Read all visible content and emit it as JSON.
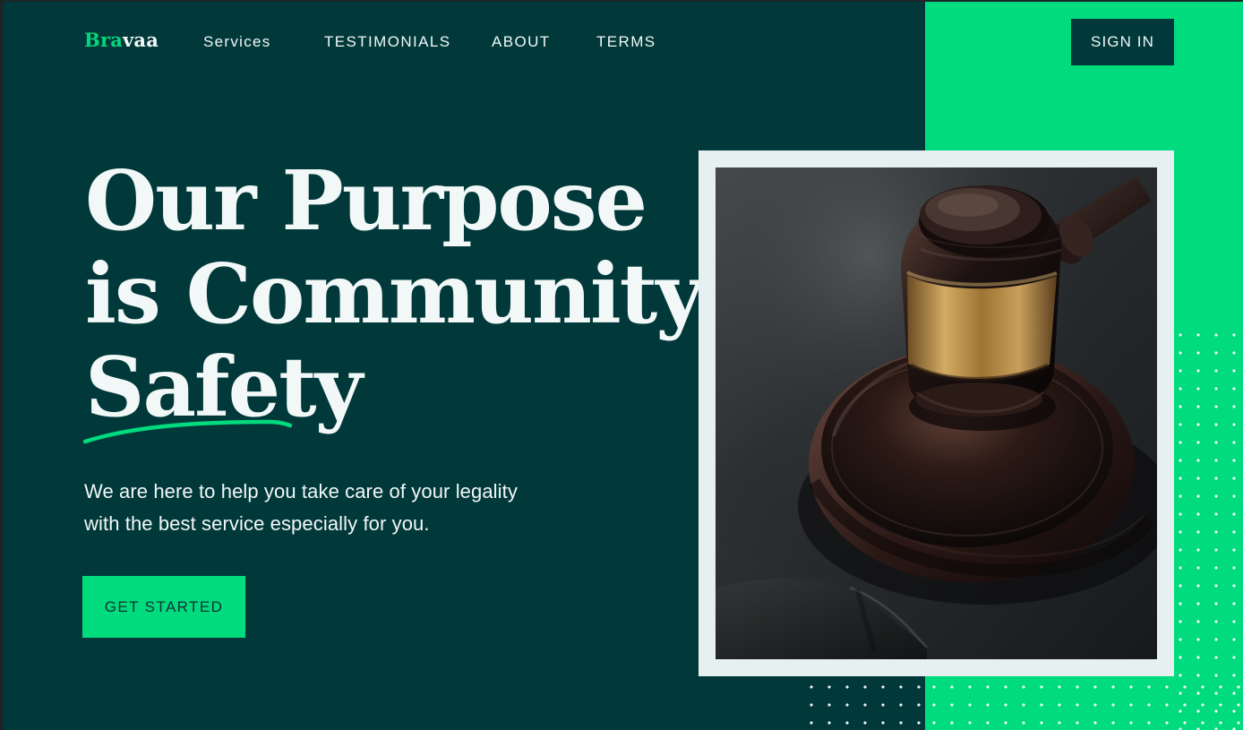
{
  "brand": {
    "part1": "Bra",
    "part2": "vaa",
    "accent_color": "#00db7d",
    "text_color": "#f2f7f7"
  },
  "nav": {
    "items": [
      {
        "label": "Services"
      },
      {
        "label": "TESTIMONIALS"
      },
      {
        "label": "ABOUT"
      },
      {
        "label": "TERMS"
      }
    ],
    "sign_in_label": "SIGN IN"
  },
  "hero": {
    "title_lines": [
      "Our Purpose",
      "is Community",
      "Safety"
    ],
    "copy_lines": [
      "We are here to help you take care of your legality",
      "with the best service especially for you."
    ],
    "cta_label": "GET STARTED"
  },
  "visual": {
    "subject": "gavel-image",
    "background_color": "#01393a",
    "panel_color": "#00db7d",
    "card_color": "#e7f0f1"
  }
}
